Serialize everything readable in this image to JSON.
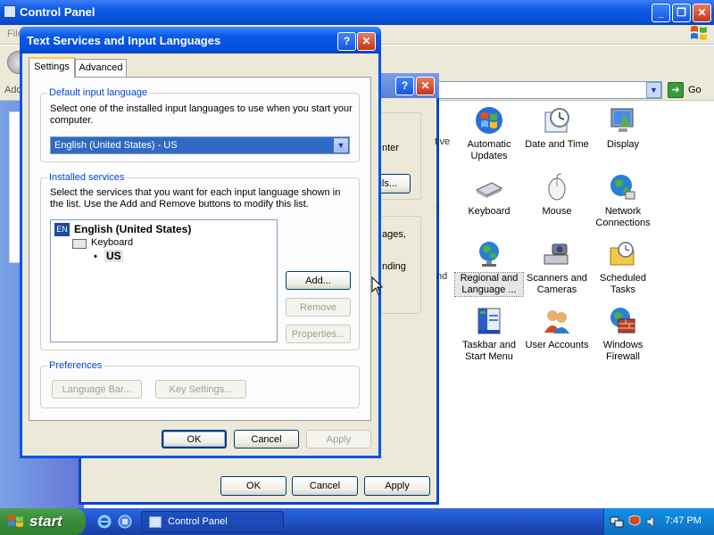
{
  "control_panel": {
    "title": "Control Panel",
    "menu_fragment": "File",
    "address_fragment": "Address",
    "go_label": "Go",
    "items": [
      {
        "label": "Automatic Updates"
      },
      {
        "label": "Date and Time"
      },
      {
        "label": "Display"
      },
      {
        "label": "Keyboard"
      },
      {
        "label": "Mouse"
      },
      {
        "label": "Network Connections"
      },
      {
        "label": "Regional and Language ..."
      },
      {
        "label": "Scanners and Cameras"
      },
      {
        "label": "Scheduled Tasks"
      },
      {
        "label": "Taskbar and Start Menu"
      },
      {
        "label": "User Accounts"
      },
      {
        "label": "Windows Firewall"
      }
    ]
  },
  "regional_dialog": {
    "fragments": [
      "nter",
      "ils...",
      "ages,",
      "nding",
      "tive",
      "t",
      "nd"
    ],
    "ok_label": "OK",
    "cancel_label": "Cancel",
    "apply_label": "Apply"
  },
  "text_services": {
    "title": "Text Services and Input Languages",
    "tabs": [
      "Settings",
      "Advanced"
    ],
    "default_input": {
      "label": "Default input language",
      "description": "Select one of the installed input languages to use when you start your computer.",
      "selected": "English (United States) - US"
    },
    "installed_services": {
      "label": "Installed services",
      "description": "Select the services that you want for each input language shown in the list. Use the Add and Remove buttons to modify this list.",
      "language_badge": "EN",
      "language": "English (United States)",
      "category": "Keyboard",
      "bullet": "•",
      "layout": "US",
      "add_label": "Add...",
      "remove_label": "Remove",
      "properties_label": "Properties..."
    },
    "preferences": {
      "label": "Preferences",
      "language_bar_label": "Language Bar...",
      "key_settings_label": "Key Settings..."
    },
    "ok_label": "OK",
    "cancel_label": "Cancel",
    "apply_label": "Apply"
  },
  "taskbar": {
    "start_label": "start",
    "task_label": "Control Panel",
    "clock": "7:47 PM"
  },
  "colors": {
    "title_blue": "#0a5ae6",
    "group_label_blue": "#0046d5",
    "selection_blue": "#316ac5",
    "start_green": "#3c8f3c",
    "dialog_face": "#ece9d8"
  }
}
